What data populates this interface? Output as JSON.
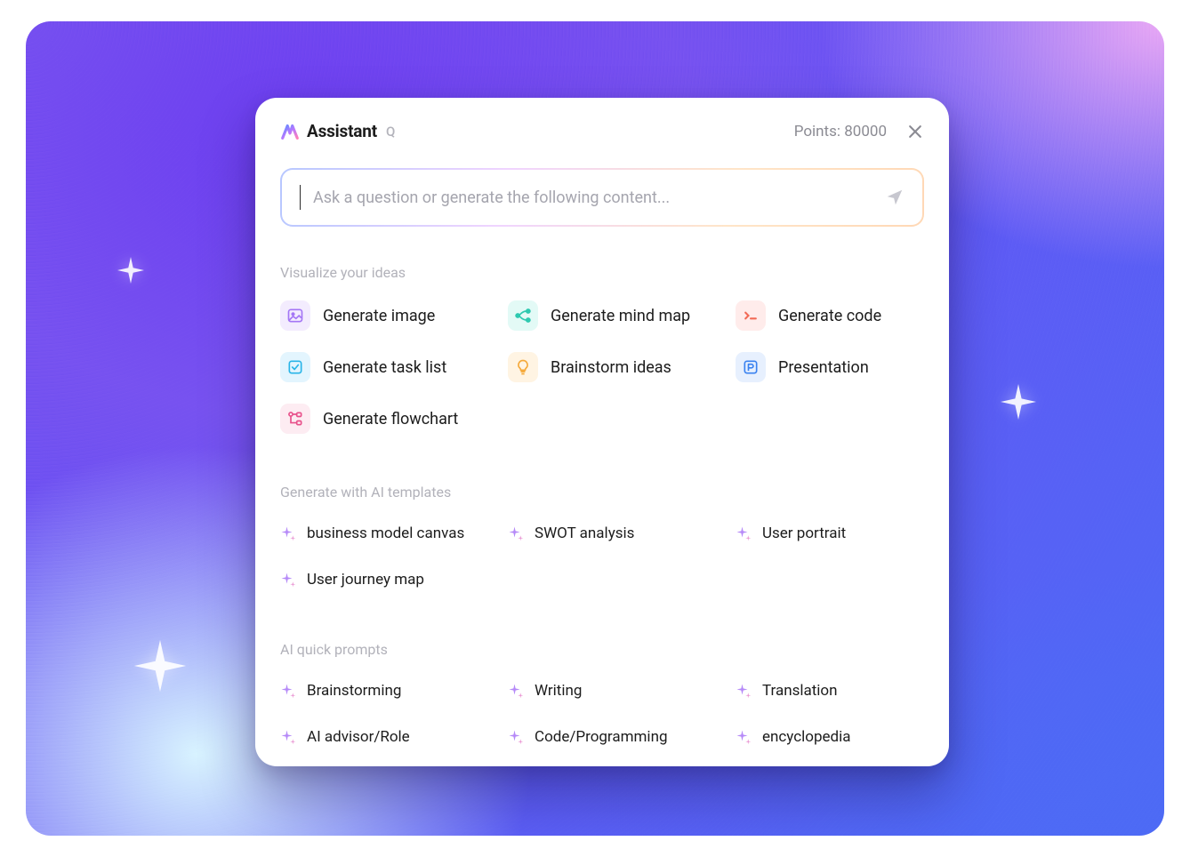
{
  "header": {
    "title": "Assistant",
    "badge": "Q",
    "points_label": "Points: 80000"
  },
  "input": {
    "placeholder": "Ask a question or generate the following content..."
  },
  "sections": {
    "visualize": {
      "title": "Visualize your ideas",
      "items": [
        {
          "label": "Generate image",
          "icon": "image-icon",
          "bg": "bg-purple",
          "fg": "c-purple"
        },
        {
          "label": "Generate mind map",
          "icon": "mindmap-icon",
          "bg": "bg-cyan-light",
          "fg": "c-teal"
        },
        {
          "label": "Generate code",
          "icon": "code-icon",
          "bg": "bg-red-light",
          "fg": "c-coral"
        },
        {
          "label": "Generate task list",
          "icon": "tasklist-icon",
          "bg": "bg-cyan-box",
          "fg": "c-cyan"
        },
        {
          "label": "Brainstorm ideas",
          "icon": "bulb-icon",
          "bg": "bg-orange-light",
          "fg": "c-orange"
        },
        {
          "label": "Presentation",
          "icon": "presentation-icon",
          "bg": "bg-blue-light",
          "fg": "c-blue"
        },
        {
          "label": "Generate flowchart",
          "icon": "flowchart-icon",
          "bg": "bg-pink-light",
          "fg": "c-pink"
        }
      ]
    },
    "templates": {
      "title": "Generate with AI templates",
      "items": [
        {
          "label": "business model canvas"
        },
        {
          "label": "SWOT analysis"
        },
        {
          "label": "User portrait"
        },
        {
          "label": "User journey map"
        }
      ]
    },
    "prompts": {
      "title": "AI quick prompts",
      "items": [
        {
          "label": "Brainstorming"
        },
        {
          "label": "Writing"
        },
        {
          "label": "Translation"
        },
        {
          "label": "AI advisor/Role"
        },
        {
          "label": "Code/Programming"
        },
        {
          "label": "encyclopedia"
        }
      ]
    }
  }
}
